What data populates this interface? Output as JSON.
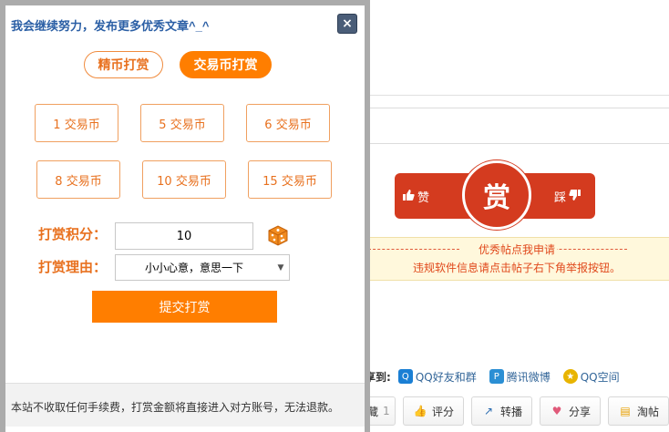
{
  "background": {
    "vote": {
      "zan_label": "赞",
      "reward_char": "赏",
      "cai_label": "踩"
    },
    "notice": {
      "title": "优秀帖点我申请",
      "text": "违规软件信息请点击帖子右下角举报按钮。"
    },
    "share": {
      "label": "享到:",
      "items": [
        {
          "label": "QQ好友和群",
          "icon": "qq-icon",
          "color": "#1a7fd4"
        },
        {
          "label": "腾讯微博",
          "icon": "tencent-weibo-icon",
          "color": "#2b8fd4"
        },
        {
          "label": "QQ空间",
          "icon": "qzone-icon",
          "color": "#e8b400"
        }
      ]
    },
    "actions": [
      {
        "label": "藏",
        "count": "1",
        "icon": "favorite-icon"
      },
      {
        "label": "评分",
        "icon": "thumb-icon"
      },
      {
        "label": "转播",
        "icon": "repost-icon"
      },
      {
        "label": "分享",
        "icon": "heart-icon"
      },
      {
        "label": "淘帖",
        "icon": "collection-icon"
      }
    ]
  },
  "dialog": {
    "title": "我会继续努力，发布更多优秀文章^_^",
    "close_label": "×",
    "tabs": [
      {
        "label": "精币打赏",
        "active": false
      },
      {
        "label": "交易币打赏",
        "active": true
      }
    ],
    "amounts": [
      "1 交易币",
      "5 交易币",
      "6 交易币",
      "8 交易币",
      "10 交易币",
      "15 交易币"
    ],
    "score_label": "打赏积分：",
    "score_value": "10",
    "reason_label": "打赏理由：",
    "reason_value": "小小心意，意思一下",
    "submit_label": "提交打赏",
    "footer": "本站不收取任何手续费，打赏金额将直接进入对方账号，无法退款。"
  },
  "colors": {
    "accent": "#ff7e00",
    "reward_red": "#d43b1f",
    "title_blue": "#2b5fa5"
  }
}
